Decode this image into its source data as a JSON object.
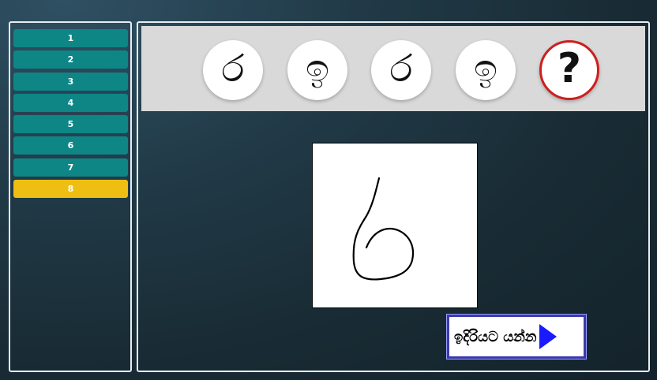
{
  "levels": [
    "1",
    "2",
    "3",
    "4",
    "5",
    "6",
    "7",
    "8"
  ],
  "active_level": "8",
  "options": [
    "ර",
    "ඉ",
    "ර",
    "ඉ"
  ],
  "help_symbol": "?",
  "next_button": {
    "label": "ඉදිරියට යන්න",
    "icon": "play-arrow-icon"
  },
  "colors": {
    "level_button": "#0e8686",
    "active_level": "#efbe12",
    "option_bar": "#d9d9d9",
    "help_ring": "#cc1f1f",
    "next_arrow": "#1a1aff"
  }
}
